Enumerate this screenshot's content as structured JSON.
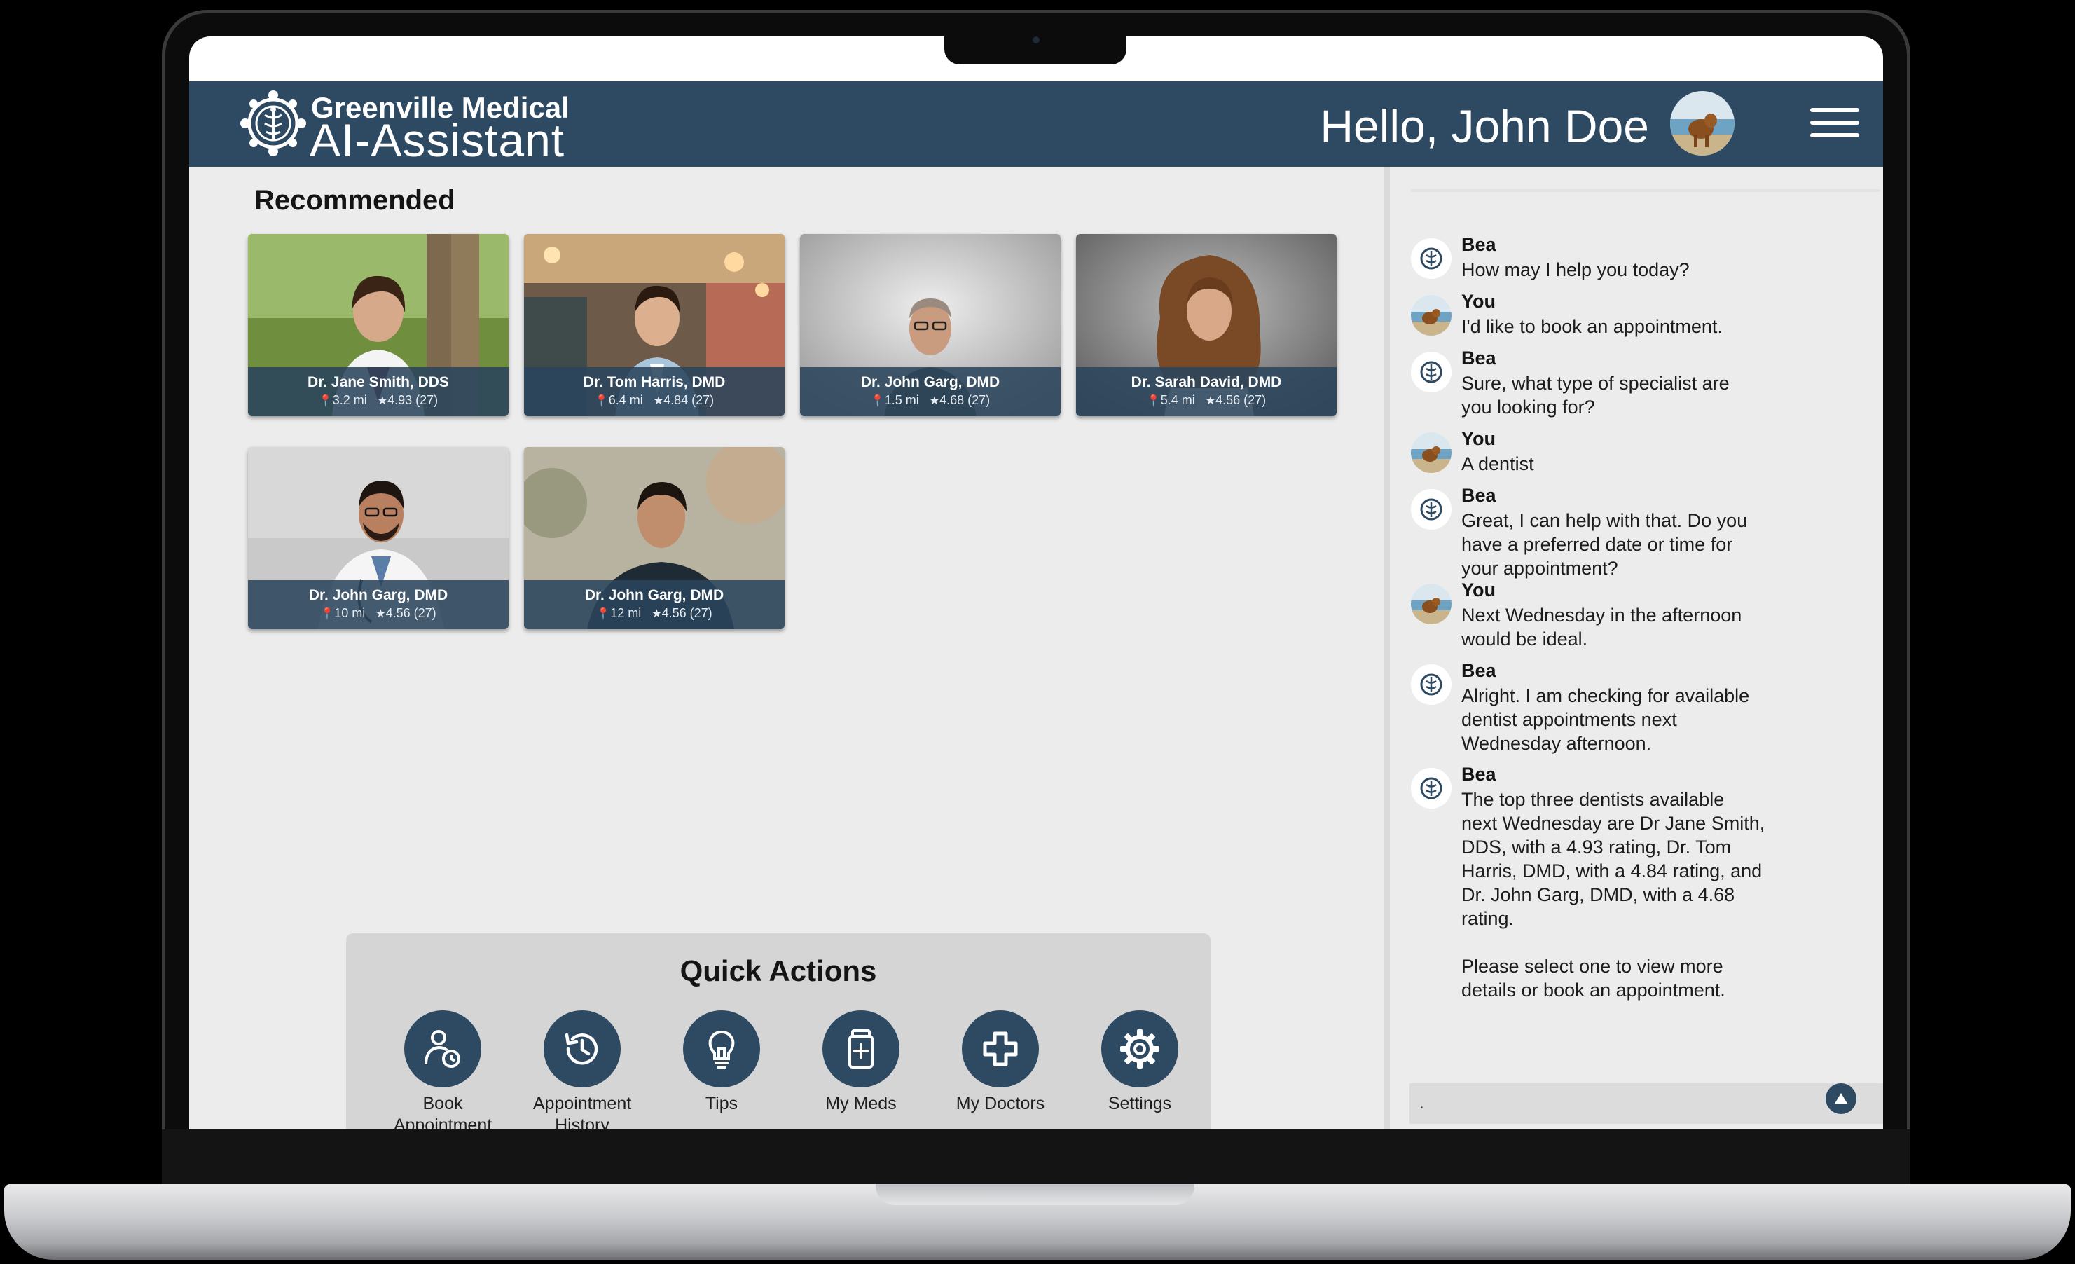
{
  "header": {
    "brand_line1": "Greenville Medical",
    "brand_line2": "AI-Assistant",
    "greeting": "Hello, John Doe",
    "logo_icon": "medical-caduceus-logo-icon",
    "menu_icon": "hamburger-menu-icon"
  },
  "recommended": {
    "title": "Recommended",
    "doctors": [
      {
        "name": "Dr. Jane Smith, DDS",
        "distance": "3.2 mi",
        "rating": "4.93 (27)"
      },
      {
        "name": "Dr. Tom Harris, DMD",
        "distance": "6.4 mi",
        "rating": "4.84 (27)"
      },
      {
        "name": "Dr. John Garg, DMD",
        "distance": "1.5 mi",
        "rating": "4.68 (27)"
      },
      {
        "name": "Dr. Sarah David, DMD",
        "distance": "5.4 mi",
        "rating": "4.56 (27)"
      },
      {
        "name": "Dr. John Garg, DMD",
        "distance": "10 mi",
        "rating": "4.56 (27)"
      },
      {
        "name": "Dr. John Garg, DMD",
        "distance": "12 mi",
        "rating": "4.56 (27)"
      }
    ]
  },
  "quick_actions": {
    "title": "Quick Actions",
    "items": [
      {
        "label": "Book\nAppointment",
        "icon": "book-appointment-icon"
      },
      {
        "label": "Appointment\nHistory",
        "icon": "history-icon"
      },
      {
        "label": "Tips",
        "icon": "lightbulb-icon"
      },
      {
        "label": "My Meds",
        "icon": "medicine-bottle-icon"
      },
      {
        "label": "My Doctors",
        "icon": "medical-cross-icon"
      },
      {
        "label": "Settings",
        "icon": "gear-icon"
      }
    ]
  },
  "chat": {
    "messages": [
      {
        "sender": "Bea",
        "text": "How may I help you today?"
      },
      {
        "sender": "You",
        "text": "I'd like to book an appointment."
      },
      {
        "sender": "Bea",
        "text": "Sure, what type of specialist are\nyou looking for?"
      },
      {
        "sender": "You",
        "text": "A dentist"
      },
      {
        "sender": "Bea",
        "text": "Great, I can help with that. Do you\nhave a preferred date or time for\nyour appointment?"
      },
      {
        "sender": "You",
        "text": "Next Wednesday in the afternoon\nwould be ideal."
      },
      {
        "sender": "Bea",
        "text": "Alright. I am checking for available\ndentist appointments next\nWednesday afternoon."
      },
      {
        "sender": "Bea",
        "text": "The top three dentists available\nnext Wednesday are Dr Jane Smith,\nDDS, with a 4.93 rating, Dr. Tom\nHarris, DMD, with a 4.84 rating, and\nDr. John Garg, DMD, with a 4.68\nrating.\n\nPlease select one to view more\ndetails or book an appointment."
      }
    ],
    "input_value": ".",
    "send_icon": "send-arrow-up-icon"
  },
  "colors": {
    "brand": "#2e4a63",
    "panel_bg": "#ececec",
    "quick_actions_bg": "#d5d5d5"
  }
}
